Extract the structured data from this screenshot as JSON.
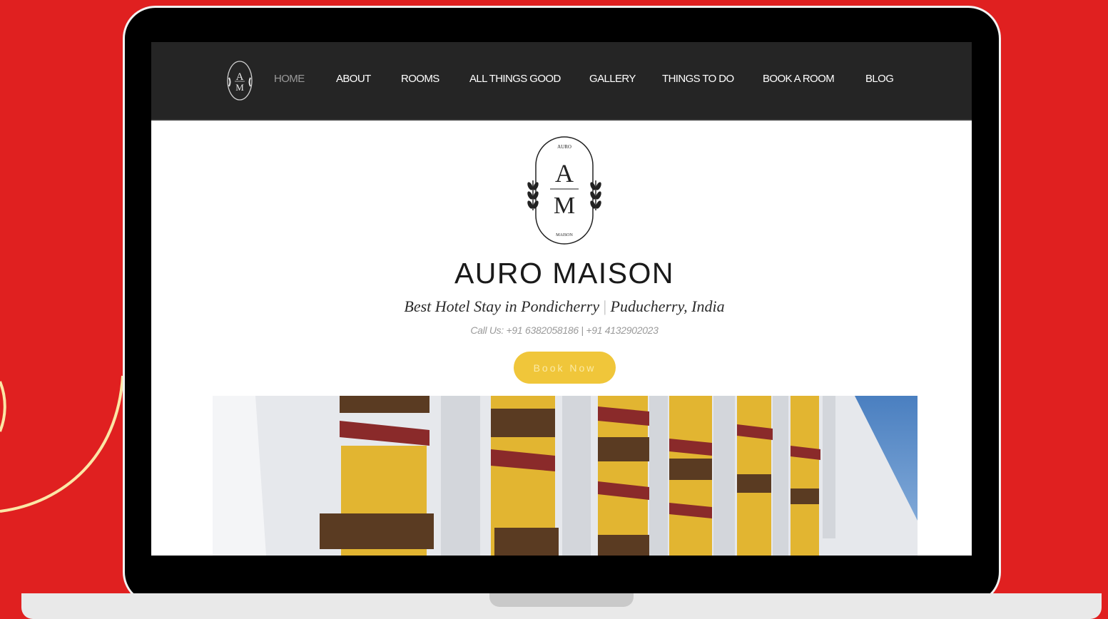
{
  "colors": {
    "background": "#e02020",
    "nav_background": "#252525",
    "button_accent": "#f0c63a",
    "decor_arc": "#fbe7a6"
  },
  "nav": {
    "logo_icon": "am-monogram-logo",
    "items": [
      {
        "label": "HOME",
        "active": true
      },
      {
        "label": "ABOUT",
        "active": false
      },
      {
        "label": "ROOMS",
        "active": false
      },
      {
        "label": "ALL THINGS GOOD",
        "active": false
      },
      {
        "label": "GALLERY",
        "active": false
      },
      {
        "label": "THINGS TO DO",
        "active": false
      },
      {
        "label": "BOOK A ROOM",
        "active": false
      },
      {
        "label": "BLOG",
        "active": false
      }
    ]
  },
  "hero": {
    "logo": {
      "icon": "auro-maison-crest-logo",
      "top_text": "AURO",
      "letter_1": "A",
      "letter_2": "M",
      "bottom_text": "MAISON"
    },
    "title": "AURO MAISON",
    "tagline_left": "Best Hotel Stay in Pondicherry",
    "tagline_sep": "|",
    "tagline_right": "Puducherry, India",
    "contact": "Call Us: +91 6382058186  | +91 4132902023",
    "book_button": "Book Now",
    "image_icon": "hotel-facade-photo"
  }
}
